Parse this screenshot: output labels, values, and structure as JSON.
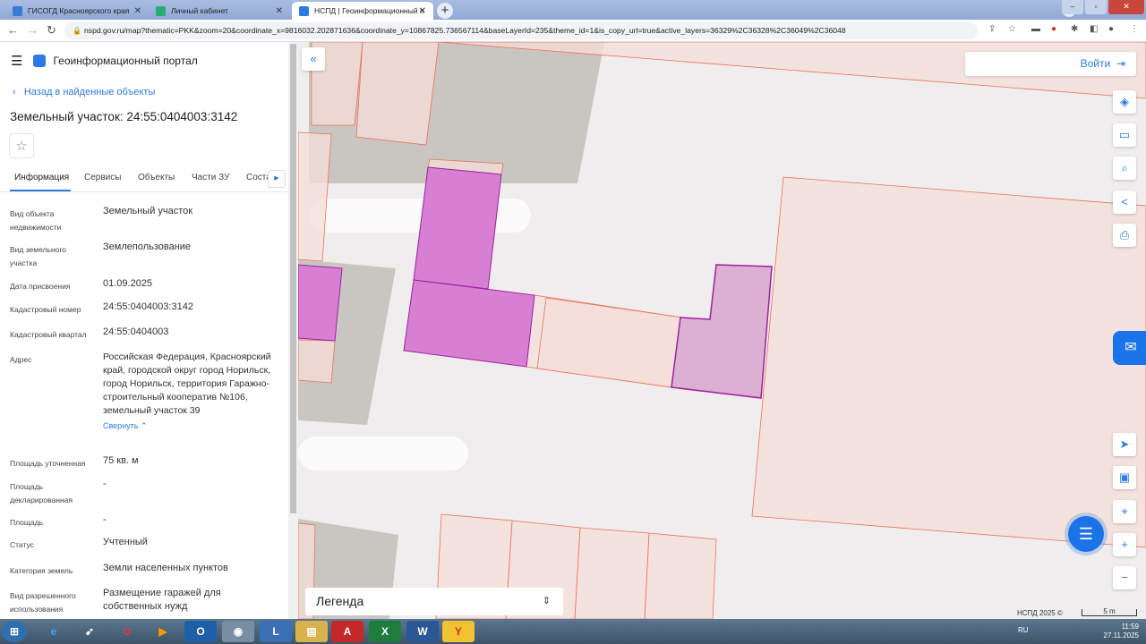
{
  "browser": {
    "tabs": [
      {
        "label": "ГИСОГД Красноярского края",
        "favicon_color": "#3a7bd5"
      },
      {
        "label": "Личный кабинет",
        "favicon_color": "#2aa876"
      },
      {
        "label": "НСПД | Геоинформационный п",
        "favicon_color": "#2c7be5"
      }
    ],
    "url": "nspd.gov.ru/map?thematic=PKK&zoom=20&coordinate_x=9816032.202871636&coordinate_y=10867825.736567114&baseLayerId=235&theme_id=1&is_copy_url=true&active_layers=36329%2C36328%2C36049%2C36048"
  },
  "panel": {
    "app_title": "Геоинформационный портал",
    "back_link": "Назад в найденные объекты",
    "title": "Земельный участок: 24:55:0404003:3142",
    "tabs": [
      "Информация",
      "Сервисы",
      "Объекты",
      "Части ЗУ",
      "Соста"
    ],
    "collapse_label": "Свернуть",
    "properties": [
      {
        "label": "Вид объекта недвижимости",
        "value": "Земельный участок"
      },
      {
        "label": "Вид земельного участка",
        "value": "Землепользование"
      },
      {
        "label": "Дата присвоения",
        "value": "01.09.2025"
      },
      {
        "label": "Кадастровый номер",
        "value": "24:55:0404003:3142"
      },
      {
        "label": "Кадастровый квартал",
        "value": "24:55:0404003"
      },
      {
        "label": "Адрес",
        "value": "Российская Федерация, Красноярский край, городской округ город Норильск, город Норильск, территория Гаражно-строительный кооператив №106, земельный участок 39"
      },
      {
        "label": "Площадь уточненная",
        "value": "75 кв. м"
      },
      {
        "label": "Площадь декларированная",
        "value": "-"
      },
      {
        "label": "Площадь",
        "value": "-"
      },
      {
        "label": "Статус",
        "value": "Учтенный"
      },
      {
        "label": "Категория земель",
        "value": "Земли населенных пунктов"
      },
      {
        "label": "Вид разрешенного использования",
        "value": "Размещение гаражей для собственных нужд"
      }
    ]
  },
  "map": {
    "login_label": "Войти",
    "legend_label": "Легенда",
    "attribution": "НСПД 2025 ©",
    "scale_label": "5 m",
    "colors": {
      "parcel_fill": "#f6ddd8",
      "parcel_stroke": "#e8735a",
      "selected_fill": "#d67fd3",
      "selected_stroke": "#a020a0",
      "accent": "#2c7be5"
    }
  },
  "taskbar": {
    "lang": "RU",
    "time": "11:59",
    "date": "27.11.2025"
  }
}
